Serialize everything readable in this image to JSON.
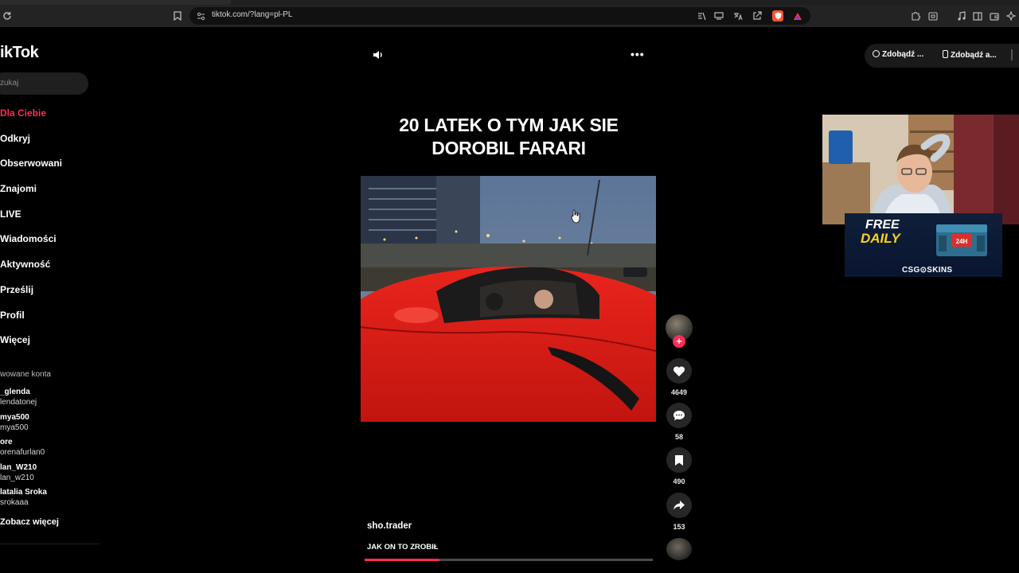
{
  "browser": {
    "url": "tiktok.com/?lang=pl-PL"
  },
  "sidebar": {
    "logo": "ikTok",
    "search_placeholder": "zukaj",
    "items": [
      {
        "label": "Dla Ciebie",
        "active": true
      },
      {
        "label": "Odkryj"
      },
      {
        "label": "Obserwowani"
      },
      {
        "label": "Znajomi"
      },
      {
        "label": "LIVE"
      },
      {
        "label": "Wiadomości"
      },
      {
        "label": "Aktywność"
      },
      {
        "label": "Prześlij"
      },
      {
        "label": "Profil"
      },
      {
        "label": "Więcej"
      }
    ],
    "followed_title": "wowane konta",
    "followed_accounts": [
      {
        "name": "_glenda",
        "handle": "lendatonej"
      },
      {
        "name": "mya500",
        "handle": "mya500"
      },
      {
        "name": "ore",
        "handle": "orenafurlan0"
      },
      {
        "name": "lan_W210",
        "handle": "lan_w210"
      },
      {
        "name": "latalia Sroka",
        "handle": "srokaaa"
      }
    ],
    "see_more": "Zobacz więcej"
  },
  "top_pills": [
    {
      "label": "Zdobądź ...",
      "icon": "clock-icon"
    },
    {
      "label": "Zdobądź a...",
      "icon": "phone-icon"
    }
  ],
  "video": {
    "overlay_title_line1": "20 LATEK O TYM JAK SIE",
    "overlay_title_line2": "DOROBIL FARARI",
    "author": "sho.trader",
    "description": "JAK ON TO ZROBIŁ",
    "progress": 0.26
  },
  "actions": {
    "likes": "4649",
    "comments": "58",
    "saves": "490",
    "shares": "153"
  },
  "ad": {
    "free": "FREE",
    "daily": "DAILY",
    "badge": "24H",
    "brand": "CSG⊙SKINS"
  },
  "colors": {
    "accent": "#fe2c55",
    "background": "#000000"
  }
}
